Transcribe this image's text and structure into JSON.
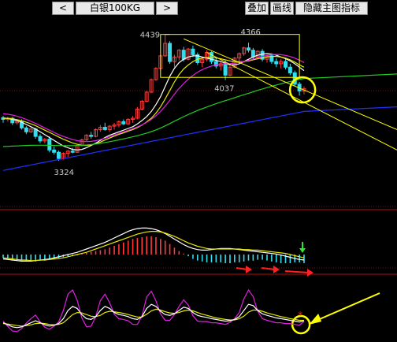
{
  "toolbar": {
    "prev_label": "<",
    "symbol": "白银100KG",
    "next_label": ">",
    "btn_add": "叠加",
    "btn_draw": "画线",
    "btn_hide": "隐藏主图指标"
  },
  "colors": {
    "bg": "#000000",
    "up": "#ff3b3b",
    "down": "#33ddee",
    "ma_white": "#ffffff",
    "ma_yellow": "#e8e800",
    "ma_magenta": "#e020e0",
    "ma_green": "#22cc22",
    "ma_blue": "#2030ff",
    "annotation": "#ffff00",
    "red_arrow": "#ff2020",
    "green_arrow": "#22ee22"
  },
  "chart_data": {
    "type": "candlestick",
    "price_labels": [
      {
        "text": "4439",
        "value": 4439
      },
      {
        "text": "4366",
        "value": 4366
      },
      {
        "text": "4037",
        "value": 4037
      },
      {
        "text": "3324",
        "value": 3324
      }
    ],
    "ylim": [
      2950,
      4520
    ],
    "candles": [
      [
        3705,
        3720,
        3660,
        3690
      ],
      [
        3690,
        3712,
        3670,
        3700
      ],
      [
        3700,
        3710,
        3640,
        3660
      ],
      [
        3660,
        3682,
        3645,
        3672
      ],
      [
        3672,
        3690,
        3600,
        3615
      ],
      [
        3615,
        3630,
        3560,
        3580
      ],
      [
        3580,
        3620,
        3570,
        3605
      ],
      [
        3605,
        3615,
        3520,
        3540
      ],
      [
        3540,
        3560,
        3480,
        3500
      ],
      [
        3500,
        3525,
        3480,
        3515
      ],
      [
        3515,
        3540,
        3400,
        3420
      ],
      [
        3420,
        3450,
        3380,
        3400
      ],
      [
        3400,
        3415,
        3324,
        3345
      ],
      [
        3345,
        3400,
        3335,
        3390
      ],
      [
        3390,
        3420,
        3360,
        3410
      ],
      [
        3410,
        3440,
        3390,
        3400
      ],
      [
        3400,
        3470,
        3395,
        3460
      ],
      [
        3460,
        3520,
        3450,
        3510
      ],
      [
        3510,
        3560,
        3500,
        3550
      ],
      [
        3550,
        3580,
        3520,
        3540
      ],
      [
        3540,
        3610,
        3530,
        3600
      ],
      [
        3600,
        3640,
        3580,
        3620
      ],
      [
        3620,
        3660,
        3590,
        3600
      ],
      [
        3600,
        3640,
        3580,
        3630
      ],
      [
        3630,
        3660,
        3600,
        3640
      ],
      [
        3640,
        3680,
        3620,
        3670
      ],
      [
        3670,
        3690,
        3640,
        3650
      ],
      [
        3650,
        3700,
        3640,
        3690
      ],
      [
        3690,
        3720,
        3660,
        3700
      ],
      [
        3700,
        3800,
        3690,
        3780
      ],
      [
        3780,
        3860,
        3770,
        3850
      ],
      [
        3850,
        3940,
        3840,
        3930
      ],
      [
        3930,
        4050,
        3920,
        4040
      ],
      [
        4040,
        4150,
        4030,
        4140
      ],
      [
        4140,
        4260,
        4120,
        4250
      ],
      [
        4250,
        4439,
        4240,
        4360
      ],
      [
        4360,
        4380,
        4180,
        4200
      ],
      [
        4200,
        4260,
        4150,
        4240
      ],
      [
        4240,
        4310,
        4210,
        4300
      ],
      [
        4300,
        4330,
        4200,
        4220
      ],
      [
        4220,
        4320,
        4210,
        4310
      ],
      [
        4310,
        4340,
        4240,
        4260
      ],
      [
        4260,
        4280,
        4170,
        4190
      ],
      [
        4190,
        4240,
        4150,
        4220
      ],
      [
        4220,
        4300,
        4200,
        4280
      ],
      [
        4280,
        4290,
        4180,
        4200
      ],
      [
        4200,
        4230,
        4140,
        4160
      ],
      [
        4160,
        4200,
        4120,
        4180
      ],
      [
        4180,
        4210,
        4037,
        4080
      ],
      [
        4080,
        4160,
        4070,
        4150
      ],
      [
        4150,
        4240,
        4140,
        4230
      ],
      [
        4230,
        4280,
        4200,
        4270
      ],
      [
        4270,
        4330,
        4250,
        4320
      ],
      [
        4320,
        4366,
        4280,
        4300
      ],
      [
        4300,
        4320,
        4220,
        4240
      ],
      [
        4240,
        4300,
        4220,
        4290
      ],
      [
        4290,
        4310,
        4200,
        4220
      ],
      [
        4220,
        4260,
        4190,
        4250
      ],
      [
        4250,
        4270,
        4180,
        4200
      ],
      [
        4200,
        4230,
        4150,
        4180
      ],
      [
        4180,
        4220,
        4140,
        4200
      ],
      [
        4200,
        4230,
        4130,
        4150
      ],
      [
        4150,
        4180,
        4080,
        4100
      ],
      [
        4100,
        4120,
        3980,
        4000
      ],
      [
        4000,
        4020,
        3900,
        3940
      ],
      [
        3940,
        3980,
        3910,
        3960
      ]
    ],
    "moving_averages": {
      "white": [
        3700,
        3698,
        3690,
        3680,
        3665,
        3645,
        3625,
        3605,
        3580,
        3555,
        3530,
        3505,
        3480,
        3455,
        3440,
        3425,
        3420,
        3425,
        3440,
        3460,
        3480,
        3505,
        3530,
        3550,
        3565,
        3580,
        3595,
        3610,
        3625,
        3650,
        3680,
        3715,
        3760,
        3820,
        3890,
        3980,
        4070,
        4140,
        4190,
        4220,
        4240,
        4250,
        4250,
        4240,
        4230,
        4220,
        4210,
        4200,
        4185,
        4170,
        4170,
        4180,
        4200,
        4220,
        4240,
        4255,
        4265,
        4270,
        4265,
        4255,
        4240,
        4225,
        4205,
        4180,
        4150,
        4120
      ],
      "yellow": [
        3700,
        3700,
        3695,
        3688,
        3678,
        3665,
        3650,
        3635,
        3615,
        3595,
        3575,
        3555,
        3535,
        3515,
        3498,
        3482,
        3470,
        3462,
        3460,
        3465,
        3475,
        3490,
        3508,
        3525,
        3542,
        3558,
        3572,
        3586,
        3600,
        3618,
        3640,
        3668,
        3700,
        3745,
        3800,
        3870,
        3945,
        4020,
        4085,
        4135,
        4170,
        4200,
        4220,
        4230,
        4235,
        4235,
        4232,
        4225,
        4215,
        4205,
        4200,
        4198,
        4200,
        4205,
        4215,
        4225,
        4232,
        4240,
        4245,
        4245,
        4240,
        4230,
        4215,
        4195,
        4170,
        4150
      ],
      "magenta": [
        3740,
        3735,
        3728,
        3718,
        3705,
        3690,
        3672,
        3655,
        3635,
        3615,
        3595,
        3575,
        3556,
        3540,
        3525,
        3512,
        3502,
        3496,
        3494,
        3496,
        3502,
        3512,
        3524,
        3538,
        3552,
        3566,
        3580,
        3594,
        3608,
        3624,
        3642,
        3664,
        3690,
        3722,
        3760,
        3806,
        3858,
        3912,
        3962,
        4006,
        4045,
        4078,
        4106,
        4128,
        4146,
        4160,
        4170,
        4176,
        4180,
        4182,
        4186,
        4192,
        4200,
        4210,
        4222,
        4234,
        4245,
        4254,
        4260,
        4262,
        4260,
        4254,
        4244,
        4230,
        4212,
        4190
      ],
      "green": [
        3450,
        3452,
        3454,
        3456,
        3458,
        3460,
        3461,
        3462,
        3462,
        3462,
        3461,
        3460,
        3459,
        3458,
        3458,
        3458,
        3459,
        3461,
        3464,
        3468,
        3473,
        3479,
        3486,
        3493,
        3501,
        3509,
        3518,
        3527,
        3536,
        3546,
        3557,
        3569,
        3582,
        3597,
        3614,
        3633,
        3653,
        3674,
        3694,
        3714,
        3733,
        3751,
        3768,
        3784,
        3799,
        3814,
        3828,
        3842,
        3855,
        3868,
        3881,
        3894,
        3907,
        3920,
        3933,
        3946,
        3958,
        3970,
        3982,
        3993,
        4004,
        4014,
        4024,
        4033,
        4042,
        4050
      ],
      "blue": [
        3240,
        3248,
        3256,
        3264,
        3272,
        3280,
        3288,
        3296,
        3304,
        3312,
        3320,
        3328,
        3336,
        3344,
        3352,
        3360,
        3368,
        3376,
        3384,
        3392,
        3400,
        3408,
        3416,
        3424,
        3432,
        3440,
        3448,
        3456,
        3464,
        3472,
        3480,
        3488,
        3496,
        3504,
        3512,
        3520,
        3528,
        3536,
        3544,
        3552,
        3560,
        3568,
        3576,
        3584,
        3592,
        3600,
        3608,
        3616,
        3624,
        3632,
        3640,
        3648,
        3656,
        3664,
        3672,
        3680,
        3688,
        3696,
        3704,
        3712,
        3720,
        3728,
        3736,
        3744,
        3752,
        3760
      ]
    },
    "macd": {
      "hist": [
        -4,
        -5,
        -6,
        -7,
        -7,
        -8,
        -8,
        -8,
        -7,
        -7,
        -6,
        -5,
        -4,
        -3,
        -2,
        -1,
        -1,
        1,
        2,
        3,
        4,
        5,
        6,
        8,
        10,
        12,
        14,
        16,
        18,
        19,
        20,
        21,
        21,
        20,
        18,
        16,
        12,
        8,
        4,
        1,
        -2,
        -5,
        -7,
        -8,
        -9,
        -9,
        -9,
        -9,
        -10,
        -10,
        -9,
        -9,
        -8,
        -7,
        -7,
        -6,
        -6,
        -7,
        -8,
        -9,
        -10,
        -10,
        -10,
        -9,
        -9,
        -10
      ],
      "dif": [
        -8,
        -9,
        -10,
        -11,
        -12,
        -12,
        -12,
        -11,
        -10,
        -9,
        -8,
        -6,
        -4,
        -2,
        0,
        2,
        4,
        7,
        10,
        13,
        16,
        19,
        22,
        26,
        30,
        34,
        38,
        42,
        45,
        47,
        48,
        48,
        47,
        45,
        42,
        38,
        33,
        28,
        23,
        18,
        14,
        11,
        9,
        8,
        8,
        9,
        10,
        11,
        11,
        11,
        10,
        9,
        8,
        7,
        6,
        5,
        4,
        3,
        2,
        1,
        -1,
        -3,
        -5,
        -7,
        -9,
        -10
      ],
      "dea": [
        -6,
        -7,
        -8,
        -9,
        -10,
        -10,
        -11,
        -11,
        -10,
        -10,
        -9,
        -8,
        -7,
        -6,
        -4,
        -2,
        0,
        2,
        4,
        7,
        10,
        13,
        16,
        19,
        22,
        25,
        28,
        31,
        34,
        37,
        39,
        41,
        42,
        42,
        41,
        39,
        36,
        33,
        29,
        25,
        21,
        18,
        15,
        13,
        11,
        10,
        10,
        10,
        10,
        10,
        10,
        10,
        9,
        9,
        8,
        8,
        7,
        6,
        5,
        4,
        3,
        2,
        0,
        -2,
        -4,
        -6
      ]
    },
    "kdj": {
      "k": [
        20,
        15,
        10,
        8,
        10,
        15,
        20,
        25,
        20,
        15,
        12,
        14,
        18,
        30,
        50,
        60,
        55,
        40,
        30,
        28,
        35,
        50,
        60,
        55,
        45,
        40,
        38,
        35,
        30,
        28,
        35,
        55,
        65,
        60,
        48,
        40,
        38,
        42,
        50,
        58,
        55,
        45,
        38,
        35,
        33,
        30,
        28,
        26,
        24,
        25,
        28,
        35,
        50,
        65,
        62,
        50,
        42,
        38,
        35,
        32,
        30,
        28,
        26,
        24,
        22,
        25
      ],
      "d": [
        18,
        17,
        15,
        13,
        12,
        13,
        15,
        18,
        19,
        18,
        16,
        15,
        16,
        20,
        30,
        40,
        45,
        44,
        40,
        36,
        35,
        38,
        45,
        48,
        47,
        45,
        43,
        40,
        37,
        34,
        34,
        41,
        49,
        53,
        51,
        47,
        44,
        43,
        45,
        49,
        51,
        49,
        45,
        41,
        38,
        35,
        32,
        30,
        28,
        27,
        27,
        30,
        36,
        46,
        51,
        51,
        48,
        44,
        41,
        38,
        35,
        33,
        30,
        28,
        26,
        26
      ],
      "j": [
        24,
        11,
        0,
        -2,
        6,
        19,
        30,
        39,
        22,
        9,
        4,
        12,
        22,
        50,
        90,
        100,
        75,
        32,
        10,
        12,
        35,
        74,
        90,
        69,
        41,
        30,
        28,
        25,
        16,
        16,
        37,
        83,
        97,
        74,
        42,
        26,
        26,
        40,
        60,
        76,
        63,
        37,
        24,
        23,
        23,
        20,
        20,
        18,
        16,
        21,
        30,
        45,
        78,
        100,
        84,
        48,
        30,
        26,
        23,
        20,
        20,
        18,
        18,
        16,
        14,
        23
      ]
    }
  }
}
